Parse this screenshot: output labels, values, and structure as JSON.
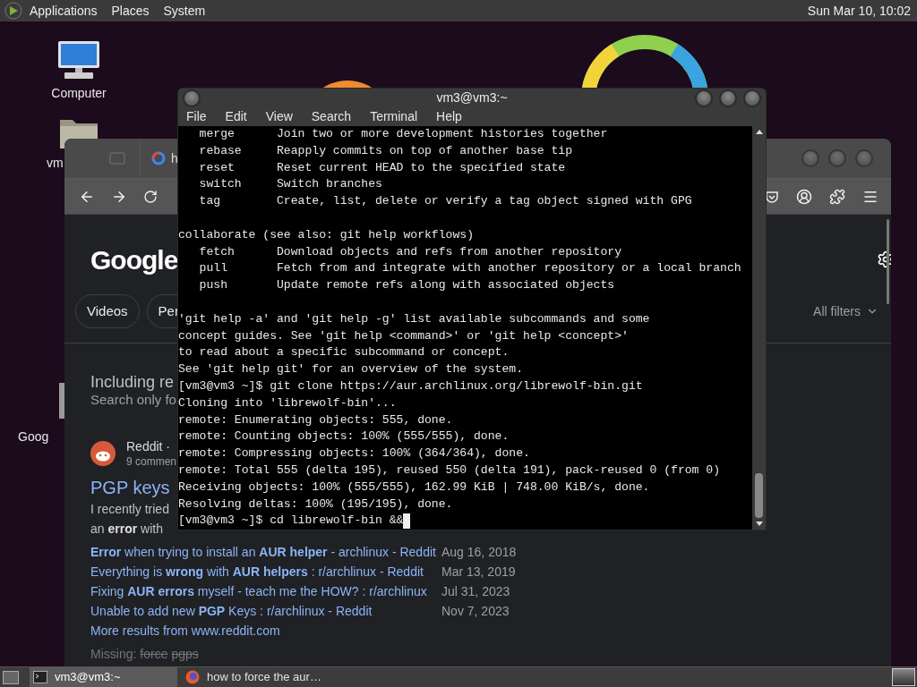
{
  "top_panel": {
    "menus": [
      "Applications",
      "Places",
      "System"
    ],
    "clock": "Sun Mar 10, 10:02"
  },
  "desktop_icons": [
    {
      "label": "Computer",
      "kind": "computer"
    },
    {
      "label": "vm",
      "kind": "folder"
    },
    {
      "label": "Goog",
      "kind": "file"
    }
  ],
  "browser": {
    "tab_title": "h",
    "logo": "Google",
    "chips": [
      "Videos",
      "Per"
    ],
    "all_filters": "All filters",
    "notice": {
      "title": "Including re",
      "subtitle": "Search only fo"
    },
    "result": {
      "source": "Reddit ·",
      "meta": "9 commen",
      "title": "PGP keys",
      "snippet": [
        "I recently tried",
        "an **error** with"
      ],
      "links": [
        {
          "text": "**Error** when trying to install an **AUR helper** - archlinux - Reddit",
          "date": "Aug 16, 2018"
        },
        {
          "text": "Everything is **wrong** with **AUR helpers** : r/archlinux - Reddit",
          "date": "Mar 13, 2019"
        },
        {
          "text": "Fixing **AUR errors** myself - teach me the HOW? : r/archlinux",
          "date": "Jul 31, 2023"
        },
        {
          "text": "Unable to add new **PGP** Keys : r/archlinux - Reddit",
          "date": "Nov 7, 2023"
        }
      ],
      "more": "More results from www.reddit.com",
      "missing_label": "Missing:",
      "missing_terms": [
        "force",
        "pgps"
      ]
    }
  },
  "terminal": {
    "title": "vm3@vm3:~",
    "menu": [
      "File",
      "Edit",
      "View",
      "Search",
      "Terminal",
      "Help"
    ],
    "blocks": [
      [
        "   merge      Join two or more development histories together",
        "   rebase     Reapply commits on top of another base tip",
        "   reset      Reset current HEAD to the specified state",
        "   switch     Switch branches",
        "   tag        Create, list, delete or verify a tag object signed with GPG"
      ],
      [
        "collaborate (see also: git help workflows)",
        "   fetch      Download objects and refs from another repository",
        "   pull       Fetch from and integrate with another repository or a local branch",
        "   push       Update remote refs along with associated objects"
      ],
      [
        "'git help -a' and 'git help -g' list available subcommands and some",
        "concept guides. See 'git help <command>' or 'git help <concept>'",
        "to read about a specific subcommand or concept.",
        "See 'git help git' for an overview of the system.",
        "[vm3@vm3 ~]$ git clone https://aur.archlinux.org/librewolf-bin.git",
        "Cloning into 'librewolf-bin'...",
        "remote: Enumerating objects: 555, done.",
        "remote: Counting objects: 100% (555/555), done.",
        "remote: Compressing objects: 100% (364/364), done.",
        "remote: Total 555 (delta 195), reused 550 (delta 191), pack-reused 0 (from 0)",
        "Receiving objects: 100% (555/555), 162.99 KiB | 748.00 KiB/s, done.",
        "Resolving deltas: 100% (195/195), done.",
        "[vm3@vm3 ~]$ cd librewolf-bin &&"
      ]
    ],
    "cursor": true
  },
  "taskbar": {
    "tasks": [
      {
        "label": "vm3@vm3:~",
        "kind": "terminal",
        "selected": true
      },
      {
        "label": "how to force the aur…",
        "kind": "browser",
        "selected": false
      }
    ]
  }
}
